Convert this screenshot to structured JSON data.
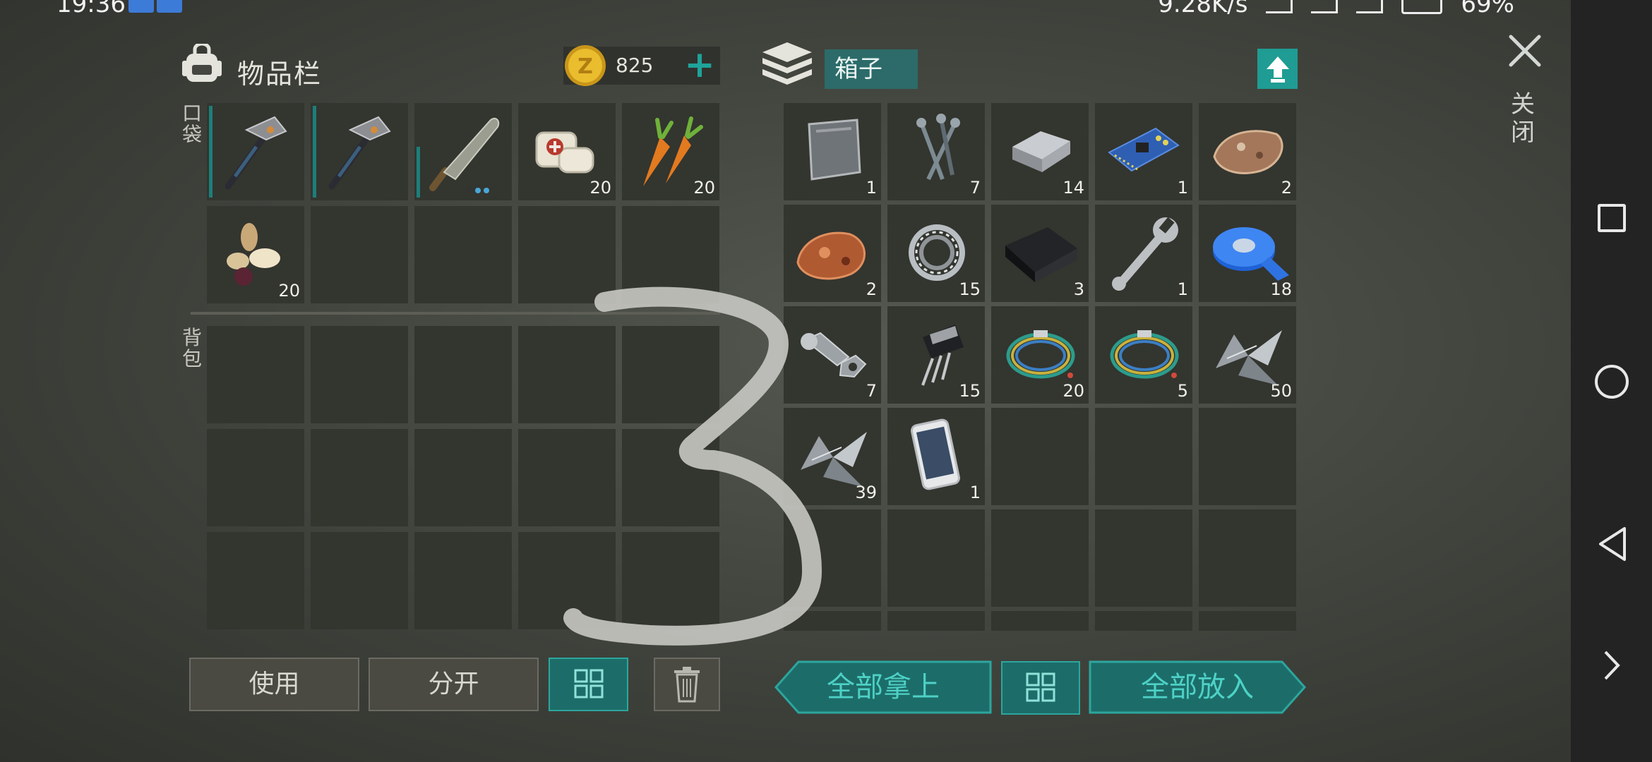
{
  "status_bar": {
    "time": "19:36",
    "speed": "9.28K/s",
    "battery": "69%"
  },
  "inventory": {
    "title": "物品栏",
    "coins": "825",
    "pocket_label": "口袋",
    "backpack_label": "背包",
    "pocket_slots": [
      {
        "icon": "pickaxe-icon",
        "qty": ""
      },
      {
        "icon": "pickaxe-icon",
        "qty": ""
      },
      {
        "icon": "machete-icon",
        "qty": ""
      },
      {
        "icon": "bandage-icon",
        "qty": "20"
      },
      {
        "icon": "carrot-icon",
        "qty": "20"
      },
      {
        "icon": "seeds-icon",
        "qty": "20"
      }
    ]
  },
  "box": {
    "title": "箱子",
    "slots": [
      {
        "icon": "metal-plate-icon",
        "qty": "1"
      },
      {
        "icon": "nails-icon",
        "qty": "7"
      },
      {
        "icon": "iron-ingot-icon",
        "qty": "14"
      },
      {
        "icon": "circuit-board-icon",
        "qty": "1"
      },
      {
        "icon": "iron-ore-icon",
        "qty": "2"
      },
      {
        "icon": "copper-ore-icon",
        "qty": "2"
      },
      {
        "icon": "bearing-icon",
        "qty": "15"
      },
      {
        "icon": "rubber-sheet-icon",
        "qty": "3"
      },
      {
        "icon": "wrench-icon",
        "qty": "1"
      },
      {
        "icon": "tape-icon",
        "qty": "18"
      },
      {
        "icon": "bolt-nut-icon",
        "qty": "7"
      },
      {
        "icon": "transistor-icon",
        "qty": "15"
      },
      {
        "icon": "wires-icon",
        "qty": "20"
      },
      {
        "icon": "wires-icon",
        "qty": "5"
      },
      {
        "icon": "scrap-metal-icon",
        "qty": "50"
      },
      {
        "icon": "scrap-metal-icon",
        "qty": "39"
      },
      {
        "icon": "smartphone-icon",
        "qty": "1"
      }
    ]
  },
  "close_label": "关闭",
  "buttons": {
    "use": "使用",
    "split": "分开",
    "take_all": "全部拿上",
    "put_all": "全部放入"
  },
  "colors": {
    "accent": "#1f9c93",
    "slot": "#33352f",
    "coin": "#e2b52a"
  }
}
